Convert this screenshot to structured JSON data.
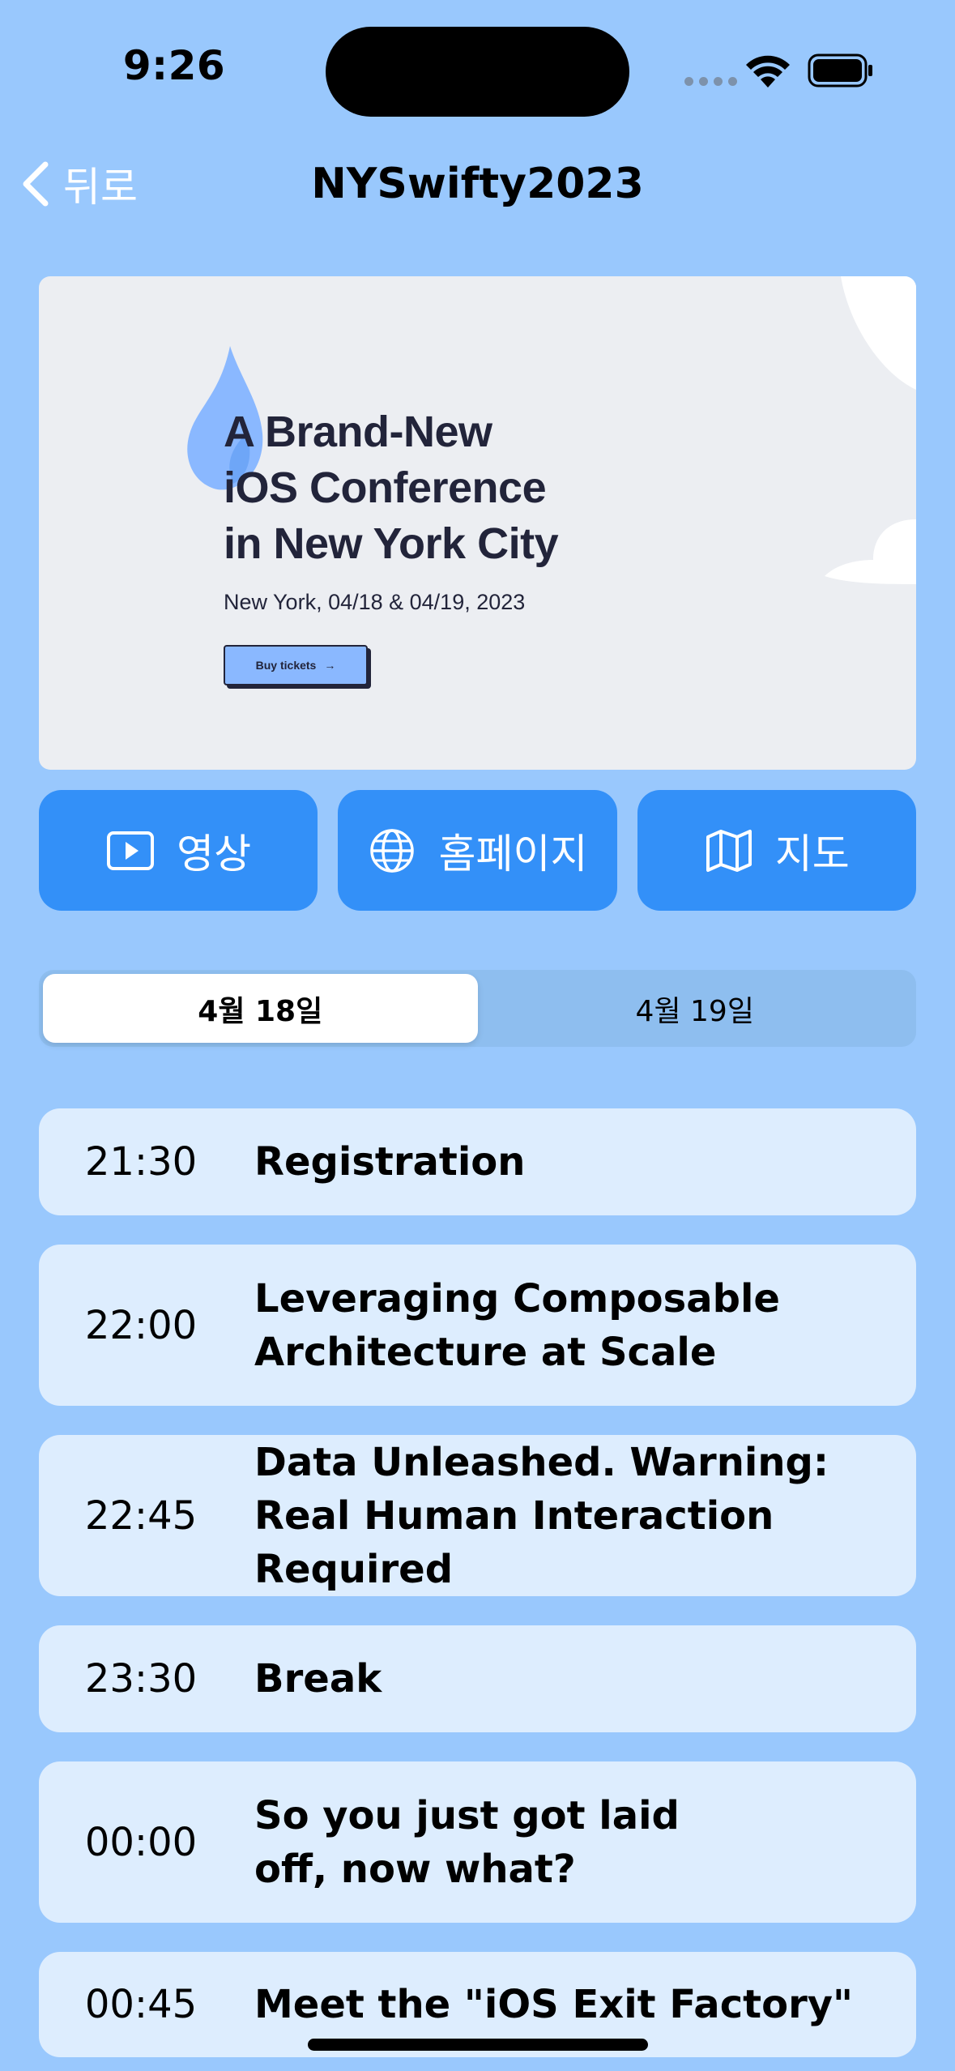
{
  "status_bar": {
    "time": "9:26"
  },
  "nav": {
    "back_label": "뒤로",
    "title": "NYSwifty2023"
  },
  "banner": {
    "headline_lines": [
      "A Brand-New",
      "iOS Conference",
      "in New York City"
    ],
    "subtitle": "New York, 04/18 & 04/19, 2023",
    "button_label": "Buy tickets",
    "button_arrow": "→"
  },
  "actions": [
    {
      "label": "영상",
      "icon": "play-rectangle-icon"
    },
    {
      "label": "홈페이지",
      "icon": "globe-icon"
    },
    {
      "label": "지도",
      "icon": "map-icon"
    }
  ],
  "days": [
    {
      "label": "4월 18일",
      "selected": true
    },
    {
      "label": "4월 19일",
      "selected": false
    }
  ],
  "schedule": [
    {
      "time": "21:30",
      "title": "Registration"
    },
    {
      "time": "22:00",
      "title": "Leveraging Composable Architecture at Scale"
    },
    {
      "time": "22:45",
      "title": "Data Unleashed. Warning: Real Human Interaction Required"
    },
    {
      "time": "23:30",
      "title": "Break"
    },
    {
      "time": "00:00",
      "title": "So you just got laid off, now what?"
    },
    {
      "time": "00:45",
      "title": "Meet the \"iOS Exit Factory\""
    }
  ],
  "colors": {
    "background": "#99c8fd",
    "accent": "#3390f8",
    "card": "#ddedfe",
    "banner": "#eceef2"
  }
}
